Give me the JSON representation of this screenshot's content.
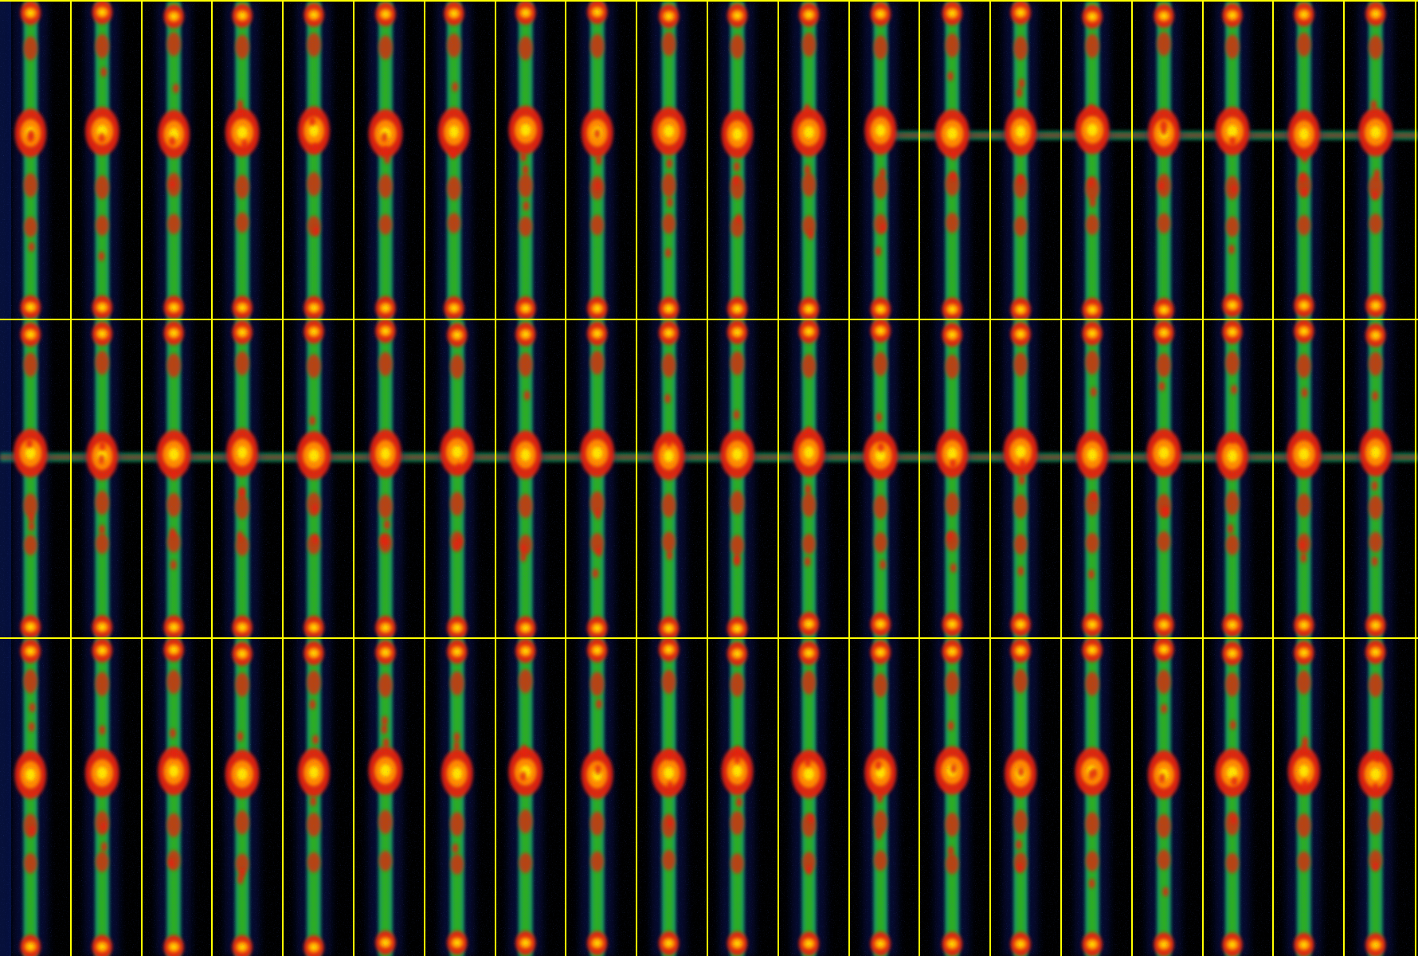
{
  "image": {
    "kind": "false-color intensity montage (heatmap panels)",
    "rows": 3,
    "columns": 20,
    "colors": {
      "background": "#000000",
      "grid_line": "#ffff00",
      "haze": "#0d1a8a",
      "low": "#1fa86a",
      "mid": "#2fb01f",
      "high": "#e5200c",
      "peak": "#ff8a00",
      "core": "#ffe400"
    },
    "rows_content": [
      {
        "row": 1,
        "bright_spot_count": 4,
        "horizontal_streak_from_column": 14
      },
      {
        "row": 2,
        "bright_spot_count": 4,
        "horizontal_streak_all_columns": true
      },
      {
        "row": 3,
        "bright_spot_count": 4,
        "horizontal_streak_all_columns": false
      }
    ]
  }
}
